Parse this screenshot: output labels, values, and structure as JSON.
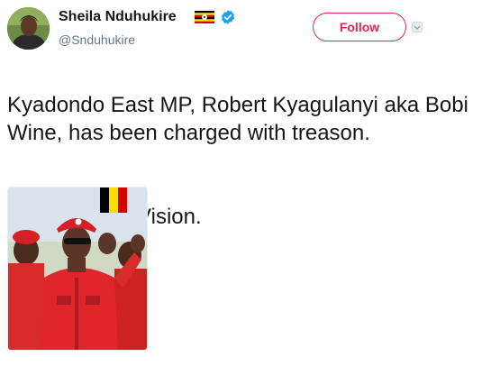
{
  "author": {
    "display_name": "Sheila Nduhukire",
    "handle": "@Snduhukire",
    "flag_icon": "uganda-flag-icon",
    "verified_icon": "verified-badge-icon"
  },
  "actions": {
    "follow_label": "Follow",
    "more_icon": "caret-menu-icon"
  },
  "tweet": {
    "text": "Kyadondo East MP, Robert Kyagulanyi aka Bobi Wine, has been charged with treason.",
    "source": "Source: New Vision."
  },
  "colors": {
    "follow_accent": "#e0245e",
    "verified_blue": "#1da1f2",
    "text_primary": "#14171a",
    "text_secondary": "#657786"
  }
}
